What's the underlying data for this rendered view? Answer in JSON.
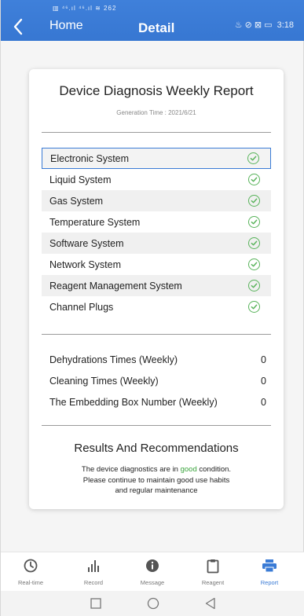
{
  "header": {
    "status_left": "▥ ⁴⁶.ıl ⁴⁶.ıl ≋ 262",
    "status_right_icons": "♨ ⊘ ⊠ ▭",
    "time": "3:18",
    "back_label": "Home",
    "title": "Detail"
  },
  "report": {
    "title": "Device Diagnosis Weekly Report",
    "generation_time": "Generation Time : 2021/6/21"
  },
  "systems": [
    {
      "label": "Electronic System",
      "status": "ok"
    },
    {
      "label": "Liquid System",
      "status": "ok"
    },
    {
      "label": "Gas System",
      "status": "ok"
    },
    {
      "label": "Temperature System",
      "status": "ok"
    },
    {
      "label": "Software System",
      "status": "ok"
    },
    {
      "label": "Network System",
      "status": "ok"
    },
    {
      "label": "Reagent Management System",
      "status": "ok"
    },
    {
      "label": "Channel Plugs",
      "status": "ok"
    }
  ],
  "counts": [
    {
      "label": "Dehydrations Times (Weekly)",
      "value": "0"
    },
    {
      "label": "Cleaning Times (Weekly)",
      "value": "0"
    },
    {
      "label": "The Embedding Box Number (Weekly)",
      "value": "0"
    }
  ],
  "results": {
    "title": "Results And Recommendations",
    "text_before": "The device diagnostics are in ",
    "text_highlight": "good",
    "text_after": " condition.",
    "line2": "Please continue to maintain good use habits",
    "line3": "and regular maintenance"
  },
  "nav": {
    "items": [
      {
        "label": "Real-time",
        "icon": "clock-icon"
      },
      {
        "label": "Record",
        "icon": "bar-chart-icon"
      },
      {
        "label": "Message",
        "icon": "info-icon"
      },
      {
        "label": "Reagent",
        "icon": "clipboard-icon"
      },
      {
        "label": "Report",
        "icon": "printer-icon",
        "active": true
      }
    ]
  },
  "colors": {
    "accent": "#3a7bd5",
    "ok": "#58b35a"
  }
}
